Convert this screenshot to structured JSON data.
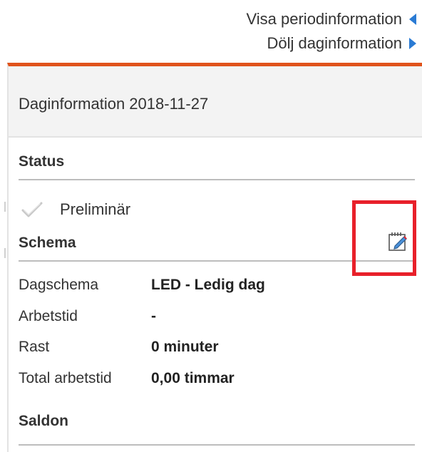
{
  "top_links": {
    "show_period": "Visa periodinformation",
    "hide_day": "Dölj daginformation"
  },
  "panel": {
    "title": "Daginformation 2018-11-27",
    "status": {
      "heading": "Status",
      "value": "Preliminär"
    },
    "schema": {
      "heading": "Schema",
      "rows": [
        {
          "label": "Dagschema",
          "value": "LED - Ledig dag"
        },
        {
          "label": "Arbetstid",
          "value": "-"
        },
        {
          "label": "Rast",
          "value": "0 minuter"
        },
        {
          "label": "Total arbetstid",
          "value": "0,00 timmar"
        }
      ]
    },
    "saldon": {
      "heading": "Saldon"
    }
  },
  "colors": {
    "accent_top_border": "#e0531c",
    "link_arrow": "#2a7bd4",
    "highlight": "#e8202a"
  },
  "icons": {
    "show_period_arrow": "triangle-left-icon",
    "hide_day_arrow": "triangle-right-icon",
    "status_check": "check-icon",
    "schema_edit": "edit-calendar-icon"
  }
}
